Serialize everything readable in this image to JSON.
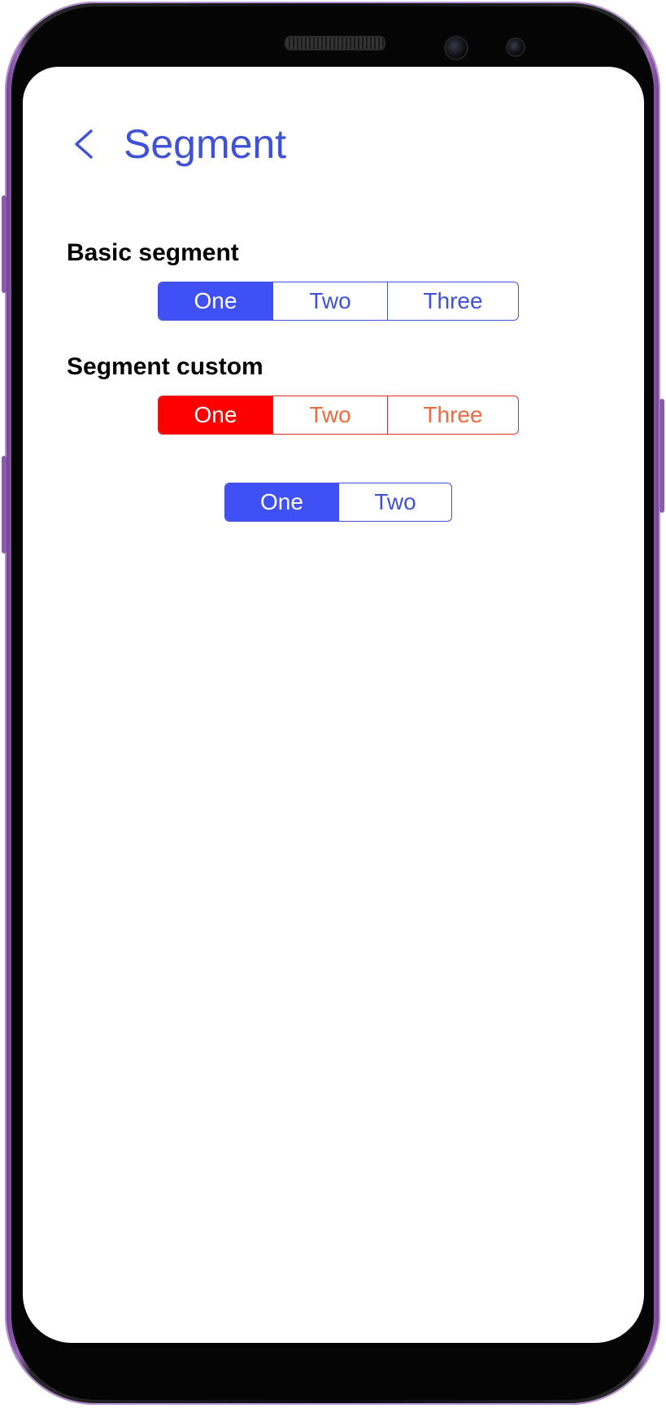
{
  "header": {
    "title": "Segment",
    "back_icon": "chevron-left-icon"
  },
  "sections": [
    {
      "title": "Basic segment",
      "segments": [
        "One",
        "Two",
        "Three"
      ],
      "selected": "One",
      "color": "#3f51f5"
    },
    {
      "title": "Segment custom",
      "segments": [
        "One",
        "Two",
        "Three"
      ],
      "selected": "One",
      "color": "#ff0000",
      "text_color": "#f06a3c"
    },
    {
      "segments": [
        "One",
        "Two"
      ],
      "selected": "One",
      "color": "#3f51f5"
    }
  ]
}
